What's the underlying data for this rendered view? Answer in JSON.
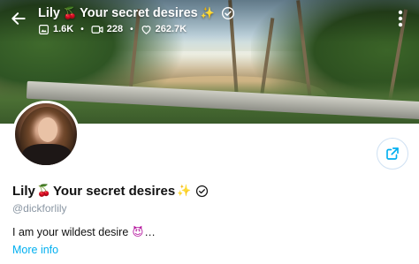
{
  "header": {
    "title_name": "Lily",
    "title_rest": "Your secret desires",
    "cherry_glyph": "🍒",
    "sparkle_glyph": "✨",
    "stats": {
      "photos": "1.6K",
      "videos": "228",
      "likes": "262.7K",
      "separator": "•"
    }
  },
  "profile": {
    "name": "Lily",
    "name_rest": "Your secret desires",
    "handle": "@dickforlily",
    "bio_text": "I am your wildest desire",
    "bio_glyph": "😈",
    "bio_ellipsis": "…",
    "more_info": "More info"
  },
  "icons": {
    "back": "arrow-left-icon",
    "more": "more-vertical-icon",
    "verified": "verified-badge-icon",
    "photos": "image-icon",
    "videos": "video-icon",
    "likes": "heart-icon",
    "share": "share-icon"
  },
  "colors": {
    "accent": "#00aff0",
    "handle": "#8a96a3",
    "text": "#111111",
    "cherry": "#c0102a"
  }
}
